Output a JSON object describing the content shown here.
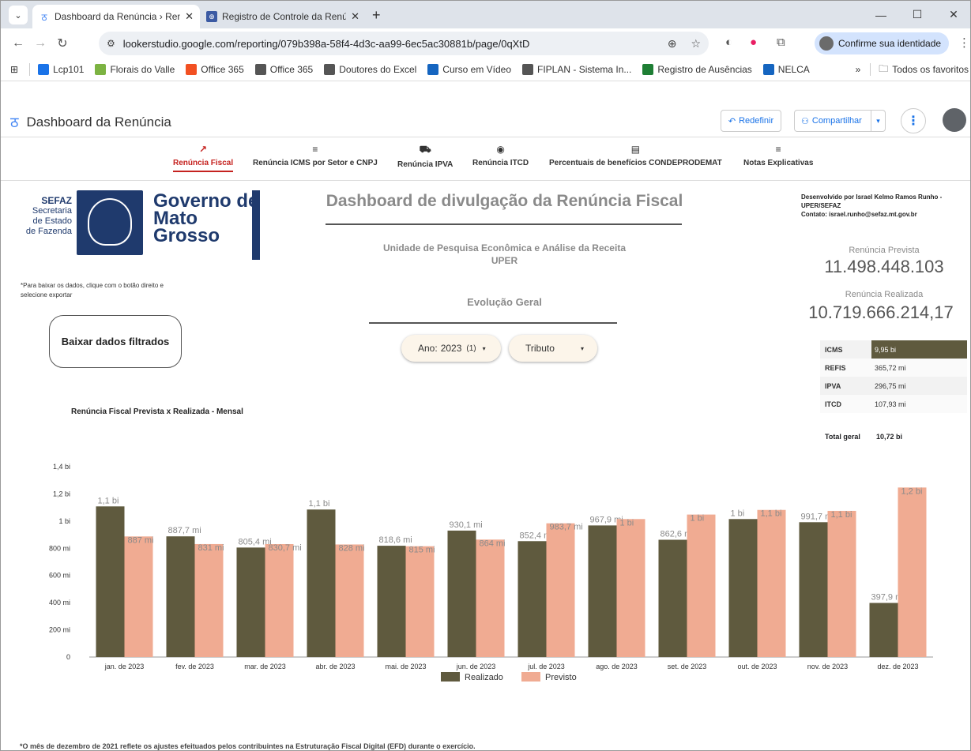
{
  "browser": {
    "tabs": [
      {
        "title": "Dashboard da Renúncia › Renún",
        "active": true
      },
      {
        "title": "Registro de Controle da Renúnc",
        "active": false
      }
    ],
    "url": "lookerstudio.google.com/reporting/079b398a-58f4-4d3c-aa99-6ec5ac30881b/page/0qXtD",
    "identity_label": "Confirme sua identidade",
    "bookmarks": [
      {
        "label": "Lcp101",
        "color": "#1a73e8"
      },
      {
        "label": "Florais do Valle",
        "color": "#7cb342"
      },
      {
        "label": "Office 365",
        "color": "#f25022"
      },
      {
        "label": "Office 365",
        "color": "#555555"
      },
      {
        "label": "Doutores do Excel",
        "color": "#555555"
      },
      {
        "label": "Curso em Vídeo",
        "color": "#1565c0"
      },
      {
        "label": "FIPLAN - Sistema In...",
        "color": "#555555"
      },
      {
        "label": "Registro de Ausências",
        "color": "#1e7e34"
      },
      {
        "label": "NELCA",
        "color": "#1565c0"
      }
    ],
    "bookmarks_more": "»",
    "all_favorites": "Todos os favoritos"
  },
  "report_header": {
    "title": "Dashboard da Renúncia",
    "reset_label": "Redefinir",
    "share_label": "Compartilhar"
  },
  "pages": [
    {
      "label": "Renúncia Fiscal",
      "active": true
    },
    {
      "label": "Renúncia ICMS por Setor e CNPJ",
      "active": false
    },
    {
      "label": "Renúncia IPVA",
      "active": false
    },
    {
      "label": "Renúncia ITCD",
      "active": false
    },
    {
      "label": "Percentuais de benefícios CONDEPRODEMAT",
      "active": false
    },
    {
      "label": "Notas Explicativas",
      "active": false
    }
  ],
  "branding": {
    "sefaz_line1": "SEFAZ",
    "sefaz_line2": "Secretaria",
    "sefaz_line3": "de Estado",
    "sefaz_line4": "de Fazenda",
    "gov_line1": "Governo de",
    "gov_line2": "Mato",
    "gov_line3": "Grosso",
    "primary_color": "#1f3a6d"
  },
  "export_note": "*Para baixar os dados, clique com o botão direito e selecione exportar",
  "download_button": "Baixar dados filtrados",
  "dashboard_title": "Dashboard de divulgação da Renúncia Fiscal",
  "unit_line1": "Unidade de Pesquisa Econômica e Análise da Receita",
  "unit_line2": "UPER",
  "section_title": "Evolução Geral",
  "filters": {
    "year_label": "Ano:",
    "year_value": "2023",
    "year_count": "(1)",
    "tax_label": "Tributo"
  },
  "developer": {
    "line1": "Desenvolvido por Israel Kelmo Ramos Runho - UPER/SEFAZ",
    "line2": "Contato: israel.runho@sefaz.mt.gov.br"
  },
  "kpis": {
    "prevista_label": "Renúncia Prevista",
    "prevista_value": "11.498.448.103",
    "realizada_label": "Renúncia Realizada",
    "realizada_value": "10.719.666.214,17"
  },
  "tax_table": {
    "rows": [
      {
        "tax": "ICMS",
        "value": "9,95 bi",
        "share": 1.0
      },
      {
        "tax": "REFIS",
        "value": "365,72 mi",
        "share": 0.037
      },
      {
        "tax": "IPVA",
        "value": "296,75 mi",
        "share": 0.03
      },
      {
        "tax": "ITCD",
        "value": "107,93 mi",
        "share": 0.011
      }
    ],
    "total_label": "Total geral",
    "total_value": "10,72 bi"
  },
  "chart_title": "Renúncia Fiscal Prevista x Realizada - Mensal",
  "chart_data": {
    "type": "bar",
    "categories": [
      "jan. de 2023",
      "fev. de 2023",
      "mar. de 2023",
      "abr. de 2023",
      "mai. de 2023",
      "jun. de 2023",
      "jul. de 2023",
      "ago. de 2023",
      "set. de 2023",
      "out. de 2023",
      "nov. de 2023",
      "dez. de 2023"
    ],
    "ylim": [
      0,
      1400000000
    ],
    "yticks": [
      {
        "value": 0,
        "label": "0"
      },
      {
        "value": 200000000,
        "label": "200 mi"
      },
      {
        "value": 400000000,
        "label": "400 mi"
      },
      {
        "value": 600000000,
        "label": "600 mi"
      },
      {
        "value": 800000000,
        "label": "800 mi"
      },
      {
        "value": 1000000000,
        "label": "1 bi"
      },
      {
        "value": 1200000000,
        "label": "1,2 bi"
      },
      {
        "value": 1400000000,
        "label": "1,4 bi"
      }
    ],
    "legend_position": "bottom",
    "series": [
      {
        "name": "Realizado",
        "color": "#5f5a3e",
        "values": [
          1108000000,
          887700000,
          805400000,
          1085000000,
          818600000,
          930100000,
          852400000,
          967900000,
          862600000,
          1015000000,
          991700000,
          397900000
        ],
        "labels": [
          "1,1 bi",
          "887,7 mi",
          "805,4 mi",
          "1,1 bi",
          "818,6 mi",
          "930,1 mi",
          "852,4 mi",
          "967,9 mi",
          "862,6 mi",
          "1 bi",
          "991,7 mi",
          "397,9 mi"
        ]
      },
      {
        "name": "Previsto",
        "color": "#f0ab92",
        "values": [
          887000000,
          831000000,
          830700000,
          828000000,
          815000000,
          864000000,
          983700000,
          1015000000,
          1048000000,
          1082000000,
          1075000000,
          1247000000
        ],
        "labels": [
          "887 mi",
          "831 mi",
          "830,7 mi",
          "828 mi",
          "815 mi",
          "864 mi",
          "983,7 mi",
          "1 bi",
          "1 bi",
          "1,1 bi",
          "1,1 bi",
          "1,2 bi"
        ]
      }
    ]
  },
  "footnote": "*O mês de dezembro de 2021  reflete os ajustes efeituados pelos contribuintes na  Estruturação Fiscal Digital (EFD) durante o exercício."
}
